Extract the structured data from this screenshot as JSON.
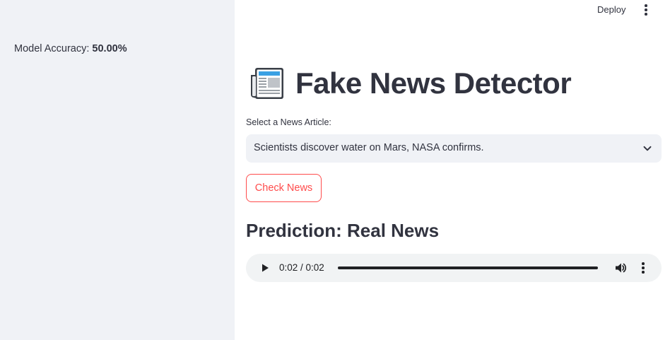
{
  "sidebar": {
    "accuracy_label": "Model Accuracy:",
    "accuracy_value": "50.00%"
  },
  "header": {
    "deploy_label": "Deploy",
    "menu_icon": "kebab-menu-icon"
  },
  "main": {
    "title_icon": "newspaper-icon",
    "title": "Fake News Detector",
    "select_label": "Select a News Article:",
    "selected_article": "Scientists discover water on Mars, NASA confirms.",
    "check_button_label": "Check News",
    "prediction": "Prediction: Real News"
  },
  "audio": {
    "time": "0:02 / 0:02",
    "progress_fraction": 1.0
  },
  "colors": {
    "sidebar_bg": "#f0f2f6",
    "accent": "#ff4b4b",
    "text": "#31333f"
  }
}
